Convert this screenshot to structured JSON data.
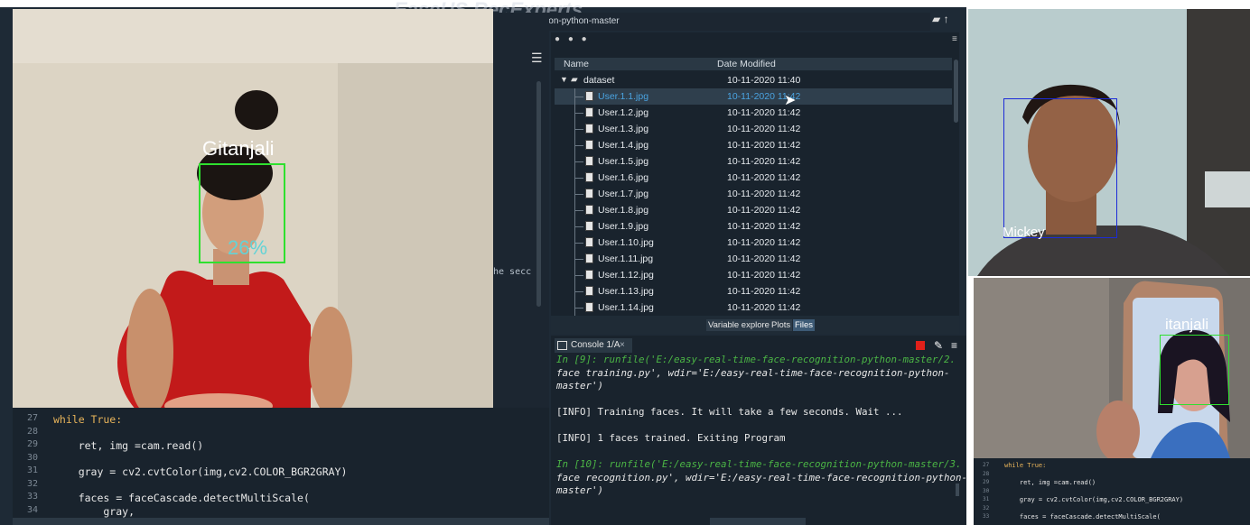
{
  "watermark": "EaseUS RecExperts",
  "path_bar": "ace-recognition-python-master",
  "editor": {
    "lines": [
      {
        "n": "27",
        "code": "while True:",
        "kw": true
      },
      {
        "n": "28",
        "code": ""
      },
      {
        "n": "29",
        "code": "    ret, img =cam.read()"
      },
      {
        "n": "30",
        "code": ""
      },
      {
        "n": "31",
        "code": "    gray = cv2.cvtColor(img,cv2.COLOR_BGR2GRAY)"
      },
      {
        "n": "32",
        "code": ""
      },
      {
        "n": "33",
        "code": "    faces = faceCascade.detectMultiScale("
      },
      {
        "n": "34",
        "code": "        gray,"
      }
    ],
    "fragment": "he secc"
  },
  "files": {
    "col_name": "Name",
    "col_date": "Date Modified",
    "folder": {
      "name": "dataset",
      "date": "10-11-2020 11:40"
    },
    "items": [
      {
        "name": "User.1.1.jpg",
        "date": "10-11-2020 11:42"
      },
      {
        "name": "User.1.2.jpg",
        "date": "10-11-2020 11:42"
      },
      {
        "name": "User.1.3.jpg",
        "date": "10-11-2020 11:42"
      },
      {
        "name": "User.1.4.jpg",
        "date": "10-11-2020 11:42"
      },
      {
        "name": "User.1.5.jpg",
        "date": "10-11-2020 11:42"
      },
      {
        "name": "User.1.6.jpg",
        "date": "10-11-2020 11:42"
      },
      {
        "name": "User.1.7.jpg",
        "date": "10-11-2020 11:42"
      },
      {
        "name": "User.1.8.jpg",
        "date": "10-11-2020 11:42"
      },
      {
        "name": "User.1.9.jpg",
        "date": "10-11-2020 11:42"
      },
      {
        "name": "User.1.10.jpg",
        "date": "10-11-2020 11:42"
      },
      {
        "name": "User.1.11.jpg",
        "date": "10-11-2020 11:42"
      },
      {
        "name": "User.1.12.jpg",
        "date": "10-11-2020 11:42"
      },
      {
        "name": "User.1.13.jpg",
        "date": "10-11-2020 11:42"
      },
      {
        "name": "User.1.14.jpg",
        "date": "10-11-2020 11:42"
      }
    ],
    "tabs": {
      "variable_explorer": "Variable explorer",
      "plots": "Plots",
      "files": "Files"
    }
  },
  "console": {
    "tab": "Console 1/A",
    "close": "×",
    "lines": [
      {
        "cls": "c-in",
        "text": "In [9]: runfile('E:/easy-real-time-face-recognition-python-master/2."
      },
      {
        "cls": "",
        "text": "face training.py', wdir='E:/easy-real-time-face-recognition-python-"
      },
      {
        "cls": "",
        "text": "master')"
      },
      {
        "cls": "",
        "text": ""
      },
      {
        "cls": "",
        "text": "[INFO] Training faces. It will take a few seconds. Wait ..."
      },
      {
        "cls": "",
        "text": ""
      },
      {
        "cls": "",
        "text": "[INFO] 1 faces trained. Exiting Program"
      },
      {
        "cls": "",
        "text": ""
      },
      {
        "cls": "c-in",
        "text": "In [10]: runfile('E:/easy-real-time-face-recognition-python-master/3."
      },
      {
        "cls": "",
        "text": "face recognition.py', wdir='E:/easy-real-time-face-recognition-python-"
      },
      {
        "cls": "",
        "text": "master')"
      }
    ]
  },
  "webcams": {
    "left": {
      "name": "Gitanjali",
      "confidence": "26%"
    },
    "right_top": {
      "name": "Mickey"
    },
    "right_bottom": {
      "name": "Gitanjali",
      "visible_text": "itanjali"
    }
  },
  "code_right": [
    {
      "n": "27",
      "code": "while True:",
      "kw": true
    },
    {
      "n": "28",
      "code": ""
    },
    {
      "n": "29",
      "code": "    ret, img =cam.read()"
    },
    {
      "n": "30",
      "code": ""
    },
    {
      "n": "31",
      "code": "    gray = cv2.cvtColor(img,cv2.COLOR_BGR2GRAY)"
    },
    {
      "n": "32",
      "code": ""
    },
    {
      "n": "33",
      "code": "    faces = faceCascade.detectMultiScale("
    }
  ],
  "colors": {
    "face_box_green": "#2fe02f",
    "face_box_blue": "#1c2bd8",
    "console_prompt_green": "#4bb545",
    "selection_blue": "#4aa3e0"
  }
}
